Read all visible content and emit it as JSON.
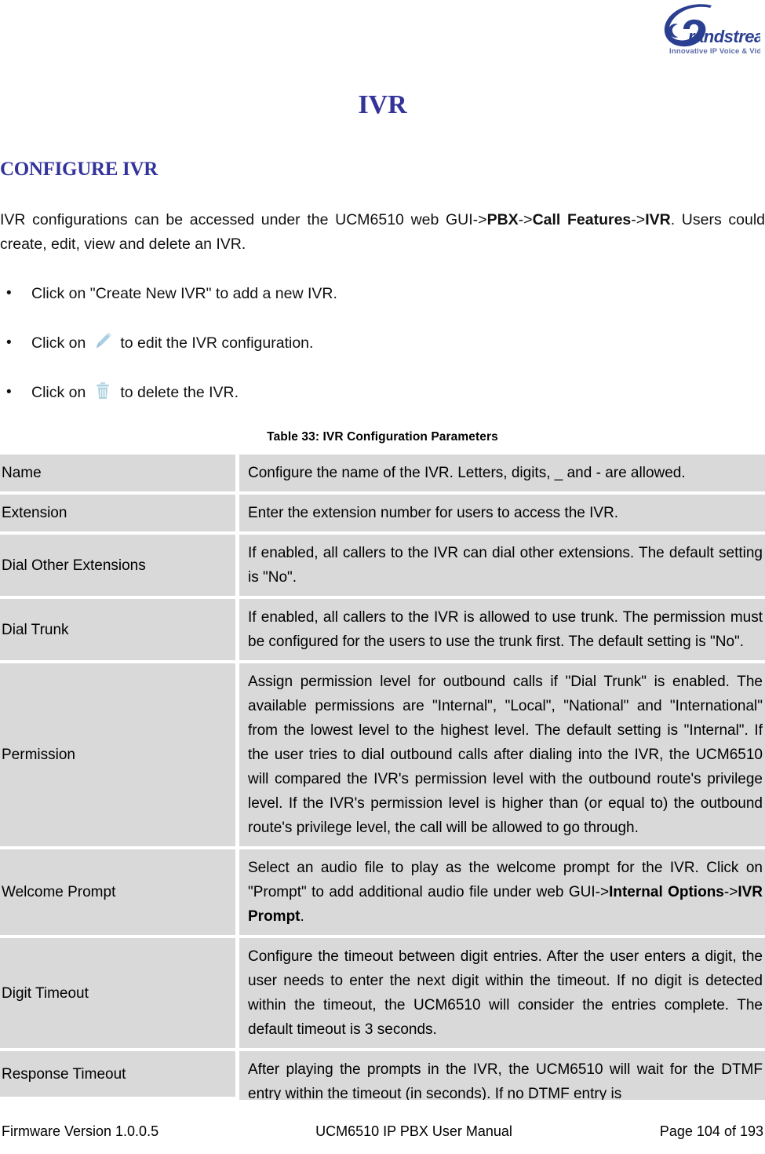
{
  "header": {
    "logo_name": "Grandstream",
    "logo_tagline": "Innovative IP Voice & Video"
  },
  "document": {
    "title": "IVR",
    "section_heading": "CONFIGURE IVR",
    "intro_paragraph": {
      "part1": "IVR configurations can be accessed under the UCM6510 web GUI->",
      "bold1": "PBX",
      "part2": "->",
      "bold2": "Call Features",
      "part3": "->",
      "bold3": "IVR",
      "part4": ". Users could create, edit, view and delete an IVR."
    },
    "bullets": [
      {
        "icon": null,
        "text_before": "Click on \"Create New IVR\" to add a new IVR.",
        "text_after": ""
      },
      {
        "icon": "pencil-edit-icon",
        "text_before": "Click on",
        "text_after": "to edit the IVR configuration."
      },
      {
        "icon": "trash-delete-icon",
        "text_before": "Click on",
        "text_after": "to delete the IVR."
      }
    ]
  },
  "table": {
    "caption": "Table 33: IVR Configuration Parameters",
    "rows": [
      {
        "label": "Name",
        "description": "Configure the name of the IVR. Letters, digits, _ and - are allowed."
      },
      {
        "label": "Extension",
        "description": "Enter the extension number for users to access the IVR."
      },
      {
        "label": "Dial Other Extensions",
        "description": "If enabled, all callers to the IVR can dial other extensions. The default setting is \"No\"."
      },
      {
        "label": "Dial Trunk",
        "description": "If enabled, all callers to the IVR is allowed to use trunk. The permission must be configured for the users to use the trunk first. The default setting is \"No\"."
      },
      {
        "label": "Permission",
        "description": "Assign permission level for outbound calls if \"Dial Trunk\" is enabled. The available permissions are \"Internal\", \"Local\", \"National\" and \"International\" from the lowest level to the highest level. The default setting is \"Internal\". If the user tries to dial outbound calls after dialing into the IVR, the UCM6510 will compared the IVR's permission level with the outbound route's privilege level. If the IVR's permission level is higher than (or equal to) the outbound route's privilege level, the call will be allowed to go through."
      },
      {
        "label": "Welcome Prompt",
        "description_part1": "Select an audio file to play as the welcome prompt for the IVR. Click on \"Prompt\" to add additional audio file under web GUI->",
        "description_bold1": "Internal Options",
        "description_part2": "->",
        "description_bold2": "IVR Prompt",
        "description_part3": "."
      },
      {
        "label": "Digit Timeout",
        "description": "Configure the timeout between digit entries. After the user enters a digit, the user needs to enter the next digit within the timeout. If no digit is detected within the timeout, the UCM6510 will consider the entries complete. The default timeout is 3 seconds."
      },
      {
        "label": "Response Timeout",
        "description": "After playing the prompts in the IVR, the UCM6510 will wait for the DTMF entry within the timeout (in seconds). If no DTMF entry is"
      }
    ]
  },
  "footer": {
    "firmware": "Firmware Version 1.0.0.5",
    "manual": "UCM6510 IP PBX User Manual",
    "page": "Page 104 of 193"
  },
  "colors": {
    "heading_blue": "#33339a",
    "table_cell_gray": "#d9d9d9",
    "icon_blue": "#a9cfe0",
    "logo_blue": "#2b3f91"
  }
}
